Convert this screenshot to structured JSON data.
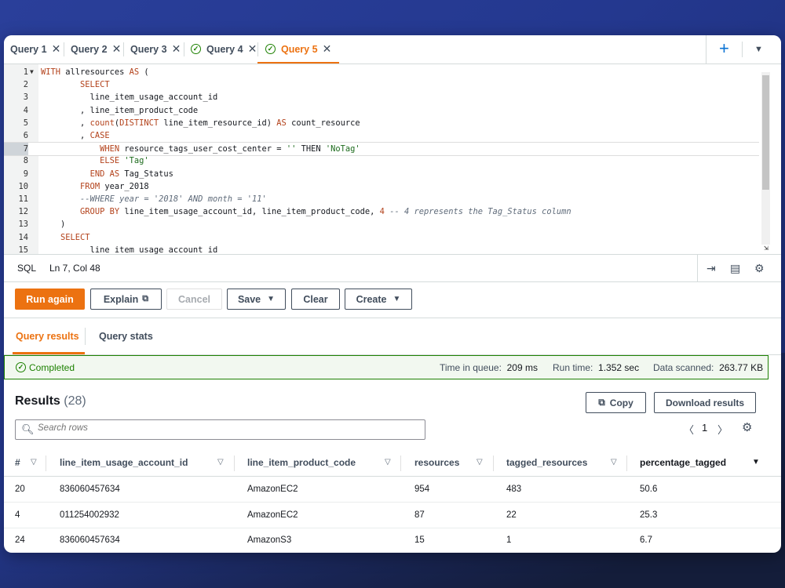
{
  "tabs": [
    {
      "label": "Query 1",
      "status": ""
    },
    {
      "label": "Query 2",
      "status": ""
    },
    {
      "label": "Query 3",
      "status": ""
    },
    {
      "label": "Query 4",
      "status": "completed"
    },
    {
      "label": "Query 5",
      "status": "completed",
      "active": true
    }
  ],
  "editor": {
    "lines": [
      {
        "n": "1",
        "fold": "▼"
      },
      {
        "n": "2"
      },
      {
        "n": "3"
      },
      {
        "n": "4"
      },
      {
        "n": "5"
      },
      {
        "n": "6"
      },
      {
        "n": "7",
        "active": true
      },
      {
        "n": "8"
      },
      {
        "n": "9"
      },
      {
        "n": "10"
      },
      {
        "n": "11"
      },
      {
        "n": "12"
      },
      {
        "n": "13"
      },
      {
        "n": "14"
      },
      {
        "n": "15"
      }
    ],
    "code": [
      [
        "kw",
        "WITH",
        "plain",
        " allresources ",
        "kw",
        "AS",
        "plain",
        " ("
      ],
      [
        "plain",
        "        ",
        "kw",
        "SELECT"
      ],
      [
        "plain",
        "          line_item_usage_account_id"
      ],
      [
        "plain",
        "        , line_item_product_code"
      ],
      [
        "plain",
        "        , ",
        "kw",
        "count",
        "plain",
        "(",
        "kw",
        "DISTINCT",
        "plain",
        " line_item_resource_id) ",
        "kw",
        "AS",
        "plain",
        " count_resource"
      ],
      [
        "plain",
        "        , ",
        "kw",
        "CASE"
      ],
      [
        "plain",
        "            ",
        "kw",
        "WHEN",
        "plain",
        " resource_tags_user_cost_center = ",
        "str",
        "''",
        "plain",
        " THEN ",
        "str",
        "'NoTag'"
      ],
      [
        "plain",
        "            ",
        "kw",
        "ELSE",
        "plain",
        " ",
        "str",
        "'Tag'"
      ],
      [
        "plain",
        "          ",
        "kw",
        "END",
        "plain",
        " ",
        "kw",
        "AS",
        "plain",
        " Tag_Status"
      ],
      [
        "plain",
        "        ",
        "kw",
        "FROM",
        "plain",
        " year_2018"
      ],
      [
        "plain",
        "        ",
        "cm",
        "--WHERE year = '2018' AND month = '11'"
      ],
      [
        "plain",
        "        ",
        "kw",
        "GROUP BY",
        "plain",
        " line_item_usage_account_id, line_item_product_code, ",
        "kw",
        "4",
        "plain",
        " ",
        "cm",
        "-- 4 represents the Tag_Status column"
      ],
      [
        "plain",
        "    )"
      ],
      [
        "plain",
        "    ",
        "kw",
        "SELECT"
      ],
      [
        "plain",
        "          line_item_usage_account_id"
      ]
    ]
  },
  "status": {
    "language": "SQL",
    "position": "Ln 7, Col 48"
  },
  "buttons": {
    "run": "Run again",
    "explain": "Explain",
    "cancel": "Cancel",
    "save": "Save",
    "clear": "Clear",
    "create": "Create"
  },
  "result_tabs": {
    "results": "Query results",
    "stats": "Query stats"
  },
  "completion": {
    "status": "Completed",
    "queue_label": "Time in queue:",
    "queue_value": "209 ms",
    "run_label": "Run time:",
    "run_value": "1.352 sec",
    "scan_label": "Data scanned:",
    "scan_value": "263.77 KB"
  },
  "results": {
    "title": "Results",
    "count": "(28)",
    "copy": "Copy",
    "download": "Download results",
    "search_placeholder": "Search rows",
    "page": "1",
    "columns": [
      "#",
      "line_item_usage_account_id",
      "line_item_product_code",
      "resources",
      "tagged_resources",
      "percentage_tagged"
    ],
    "rows": [
      [
        "20",
        "836060457634",
        "AmazonEC2",
        "954",
        "483",
        "50.6"
      ],
      [
        "4",
        "011254002932",
        "AmazonEC2",
        "87",
        "22",
        "25.3"
      ],
      [
        "24",
        "836060457634",
        "AmazonS3",
        "15",
        "1",
        "6.7"
      ]
    ]
  },
  "colors": {
    "accent": "#ec7211",
    "success": "#1d8102",
    "link": "#0972d3"
  }
}
